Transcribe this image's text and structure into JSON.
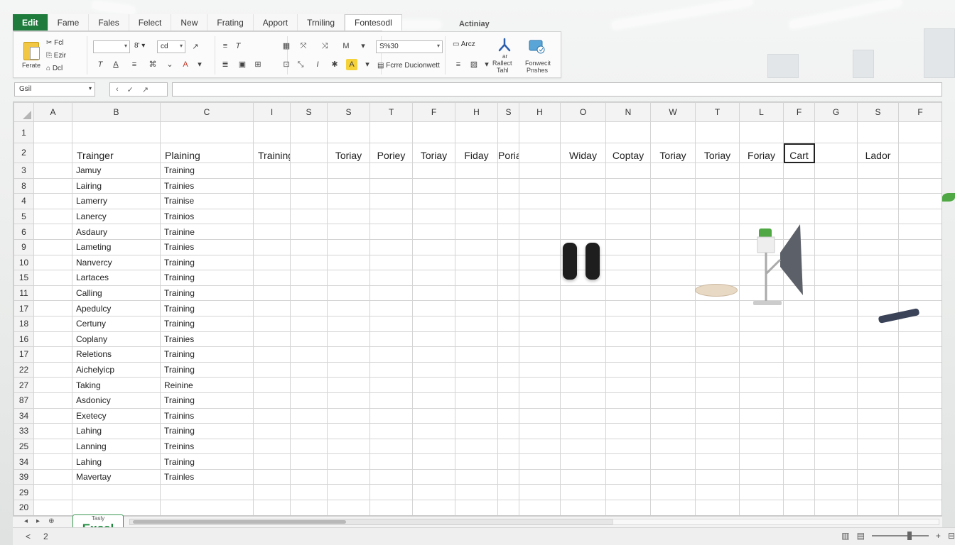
{
  "ribbon_tabs": [
    "Edit",
    "Fame",
    "Fales",
    "Felect",
    "New",
    "Frating",
    "Apport",
    "Trniling",
    "Fontesodl"
  ],
  "floating_label": "Actiniay",
  "ribbon": {
    "paste_label": "Ferate",
    "clip_items": [
      "Fcl",
      "Ezir",
      "Dcl"
    ],
    "font_box": "",
    "size_a": "8'",
    "size_b": "cd",
    "number_box": "S%30",
    "number_label": "Fcrre Ducionwett",
    "find_label": "Arcz",
    "ad_label_1": "ar",
    "ad_label_2": "Rallect",
    "ad_label_3": "Tahl",
    "far_label_1": "Fonwecit",
    "far_label_2": "Pnshes"
  },
  "formula": {
    "namebox": "Gsil",
    "fx_left": "‹",
    "fx_mid": "✓",
    "fx_right": "↗"
  },
  "columns": [
    "A",
    "B",
    "C",
    "I",
    "S",
    "S",
    "T",
    "F",
    "H",
    "S",
    "H",
    "O",
    "N",
    "W",
    "T",
    "L",
    "F",
    "G",
    "S",
    "F"
  ],
  "header_row": [
    "",
    "Trainger",
    "Plaining",
    "Training",
    "",
    "Toriay",
    "Poriey",
    "Toriay",
    "Fiday",
    "Poriay",
    "",
    "Widay",
    "Coptay",
    "Toriay",
    "Toriay",
    "Foriay",
    "Cart",
    "",
    "Lador",
    ""
  ],
  "row_numbers": [
    "1",
    "2",
    "3",
    "8",
    "4",
    "5",
    "6",
    "9",
    "10",
    "15",
    "11",
    "17",
    "18",
    "16",
    "17",
    "22",
    "27",
    "87",
    "34",
    "33",
    "25",
    "34",
    "39",
    "29",
    "20"
  ],
  "data_rows": [
    {
      "name": "Jamuy",
      "type": "Training"
    },
    {
      "name": "Lairing",
      "type": "Trainies"
    },
    {
      "name": "Lamerry",
      "type": "Trainise"
    },
    {
      "name": "Lanercy",
      "type": "Trainios"
    },
    {
      "name": "Asdaury",
      "type": "Trainine"
    },
    {
      "name": "Lameting",
      "type": "Trainies"
    },
    {
      "name": "Nanvercy",
      "type": "Training"
    },
    {
      "name": "Lartaces",
      "type": "Training"
    },
    {
      "name": "Calling",
      "type": "Training"
    },
    {
      "name": "Apedulcy",
      "type": "Training"
    },
    {
      "name": "Certuny",
      "type": "Training"
    },
    {
      "name": "Coplany",
      "type": "Trainies"
    },
    {
      "name": "Reletions",
      "type": "Training"
    },
    {
      "name": "Aichelyicp",
      "type": "Training"
    },
    {
      "name": "Taking",
      "type": "Reinine"
    },
    {
      "name": "Asdonicy",
      "type": "Training"
    },
    {
      "name": "Exetecy",
      "type": "Trainins"
    },
    {
      "name": "Lahing",
      "type": "Training"
    },
    {
      "name": "Lanning",
      "type": "Treinins"
    },
    {
      "name": "Lahing",
      "type": "Training"
    },
    {
      "name": "Mavertay",
      "type": "Trainles"
    }
  ],
  "sheet_tab": {
    "small": "Tasly",
    "big": "Excel"
  },
  "status": {
    "left_arrow": "<",
    "page": "2",
    "plus": "+"
  },
  "colors": {
    "excel_green": "#1e7b3c",
    "highlight_yellow": "#f6d23a"
  }
}
